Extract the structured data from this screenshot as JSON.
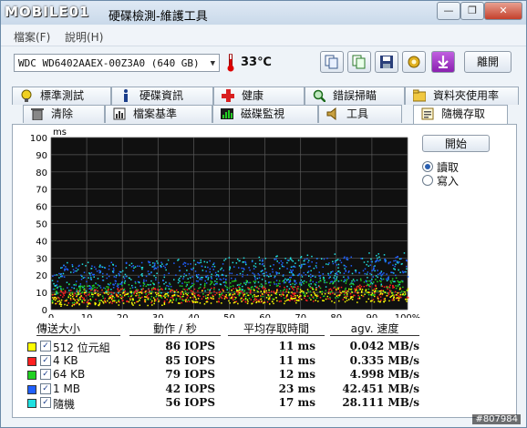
{
  "app": {
    "logo_text": "MOBILE01",
    "title": "硬碟檢測-維護工具",
    "window_buttons": [
      "—",
      "❐",
      "✕"
    ]
  },
  "menu": [
    {
      "label": "檔案(F)"
    },
    {
      "label": "說明(H)"
    }
  ],
  "toolbar": {
    "drive": "WDC WD6402AAEX-00Z3A0 (640 GB)",
    "temperature": "33",
    "temperature_unit": "℃",
    "exit_label": "離開",
    "icons": [
      "copy-icon",
      "copy-icon",
      "save-icon",
      "options-icon",
      "download-icon"
    ]
  },
  "tabs_back": [
    {
      "label": "標準測試",
      "icon": "lightbulb-icon"
    },
    {
      "label": "硬碟資訊",
      "icon": "info-icon"
    },
    {
      "label": "健康",
      "icon": "health-cross-icon"
    },
    {
      "label": "錯誤掃瞄",
      "icon": "magnifier-icon"
    },
    {
      "label": "資料夾使用率",
      "icon": "folder-icon"
    }
  ],
  "tabs_front": [
    {
      "label": "清除",
      "icon": "trash-icon"
    },
    {
      "label": "檔案基準",
      "icon": "file-benchmark-icon"
    },
    {
      "label": "磁碟監視",
      "icon": "monitor-chart-icon"
    },
    {
      "label": "工具",
      "icon": "speaker-tool-icon"
    },
    {
      "label": "隨機存取",
      "icon": "random-access-icon",
      "active": true
    }
  ],
  "controls": {
    "start_label": "開始",
    "radio_read": "讀取",
    "radio_write": "寫入",
    "selected": "read"
  },
  "chart_data": {
    "type": "scatter",
    "ylabel": "ms",
    "ylim": [
      0,
      100
    ],
    "xlim": [
      0,
      100
    ],
    "y_ticks": [
      "0",
      "10",
      "20",
      "30",
      "40",
      "50",
      "60",
      "70",
      "80",
      "90",
      "100"
    ],
    "x_ticks": [
      "0",
      "10",
      "20",
      "30",
      "40",
      "50",
      "60",
      "70",
      "80",
      "90",
      "100%"
    ],
    "grid": true,
    "series": [
      {
        "name": "512 位元組",
        "color": "#ffff00",
        "y_range": [
          2,
          13
        ]
      },
      {
        "name": "4 KB",
        "color": "#ff2020",
        "y_range": [
          3,
          15
        ]
      },
      {
        "name": "64 KB",
        "color": "#20d020",
        "y_range": [
          4,
          19
        ]
      },
      {
        "name": "1 MB",
        "color": "#2060ff",
        "y_range": [
          12,
          32
        ]
      },
      {
        "name": "隨機",
        "color": "#20e0e0",
        "y_range": [
          8,
          34
        ]
      }
    ]
  },
  "legend_table": {
    "headers": [
      "傳送大小",
      "動作 / 秒",
      "平均存取時間",
      "agv. 速度"
    ],
    "rows": [
      {
        "label": "512 位元組",
        "color": "#ffff00",
        "checked": "✓",
        "iops": "86 IOPS",
        "latency": "11 ms",
        "speed": "0.042 MB/s"
      },
      {
        "label": "4 KB",
        "color": "#ff2020",
        "checked": "✓",
        "iops": "85 IOPS",
        "latency": "11 ms",
        "speed": "0.335 MB/s"
      },
      {
        "label": "64 KB",
        "color": "#20d020",
        "checked": "✓",
        "iops": "79 IOPS",
        "latency": "12 ms",
        "speed": "4.998 MB/s"
      },
      {
        "label": "1 MB",
        "color": "#2060ff",
        "checked": "✓",
        "iops": "42 IOPS",
        "latency": "23 ms",
        "speed": "42.451 MB/s"
      },
      {
        "label": "隨機",
        "color": "#20e0e0",
        "checked": "✓",
        "iops": "56 IOPS",
        "latency": "17 ms",
        "speed": "28.111 MB/s"
      }
    ]
  },
  "watermark": "#807984"
}
